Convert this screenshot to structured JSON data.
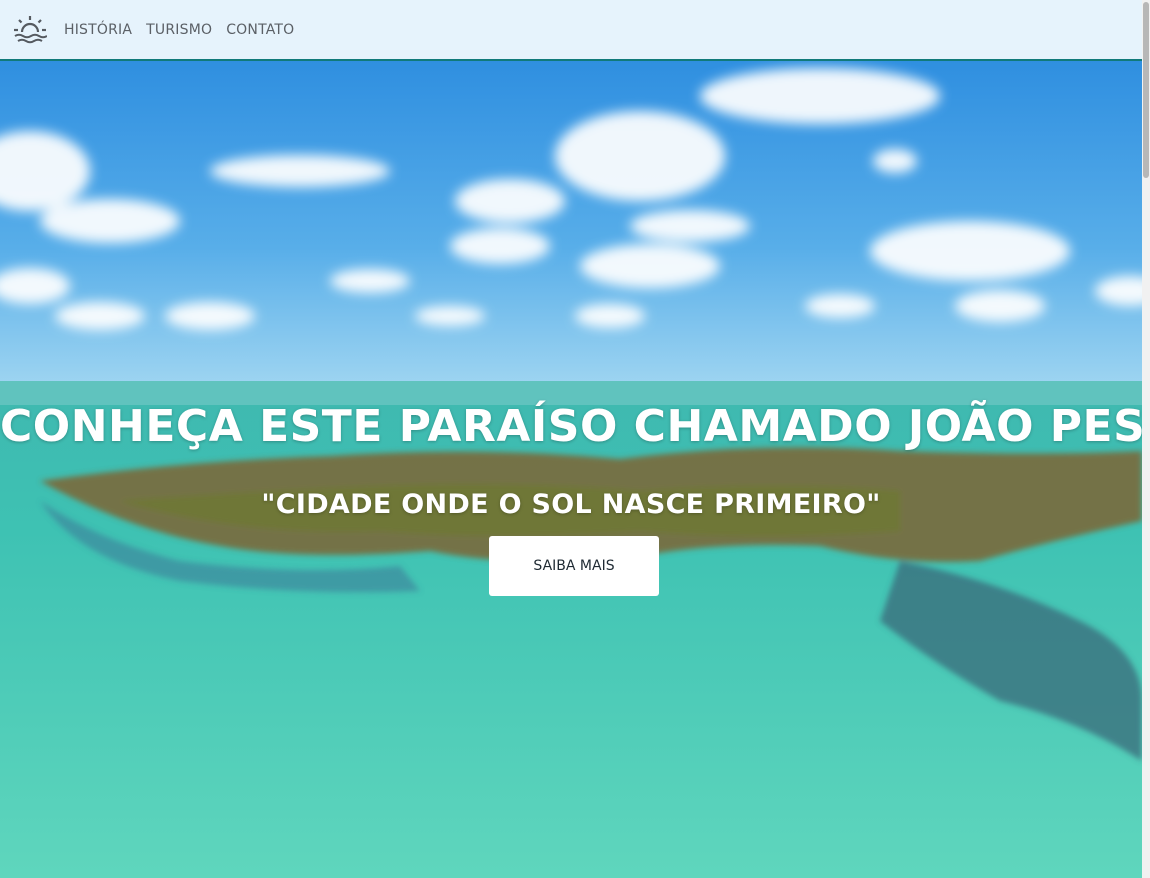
{
  "nav": {
    "logo_icon": "sunrise-icon",
    "links": [
      "HISTÓRIA",
      "TURISMO",
      "CONTATO"
    ]
  },
  "hero": {
    "title": "CONHEÇA ESTE PARAÍSO CHAMADO JOÃO PESSOA",
    "subtitle": "\"CIDADE ONDE O SOL NASCE PRIMEIRO\"",
    "cta_label": "SAIBA MAIS"
  },
  "colors": {
    "navbar_bg": "#e6f3fc",
    "navbar_border": "#117a7a",
    "nav_text": "#5b6066",
    "hero_text": "#ffffff",
    "cta_bg": "#ffffff"
  }
}
